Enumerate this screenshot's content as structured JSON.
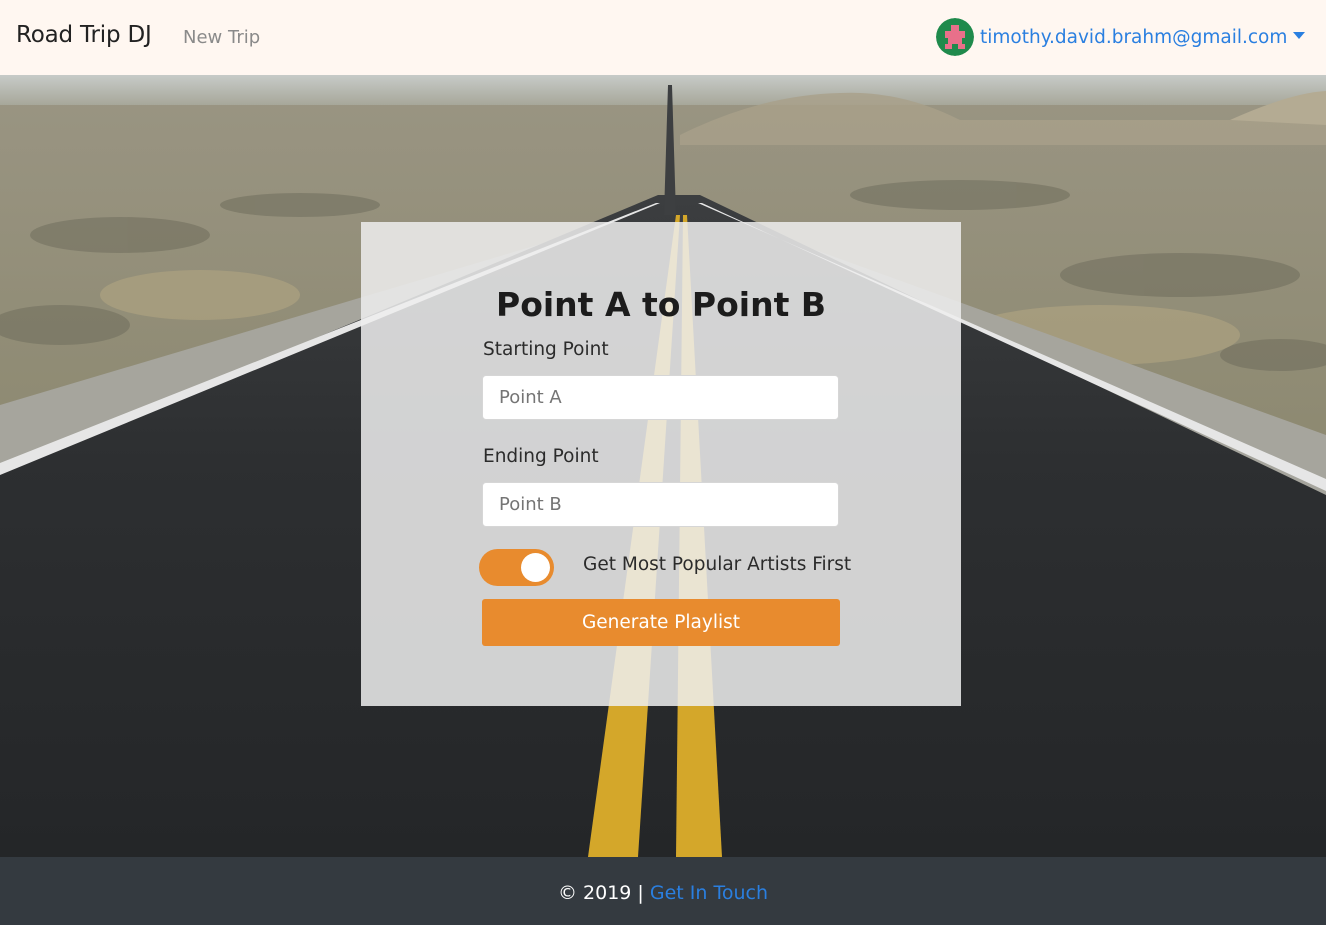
{
  "navbar": {
    "brand": "Road Trip DJ",
    "new_trip_label": "New Trip",
    "user_email": "timothy.david.brahm@gmail.com",
    "accent_color": "#2a7fe0",
    "background_color": "#fff7f1"
  },
  "form": {
    "title": "Point A to Point B",
    "start_label": "Starting Point",
    "start_placeholder": "Point A",
    "end_label": "Ending Point",
    "end_placeholder": "Point B",
    "popular_toggle_label": "Get Most Popular Artists First",
    "popular_toggle_on": true,
    "submit_label": "Generate Playlist",
    "accent_color": "#e88b2e"
  },
  "footer": {
    "copyright": "© 2019 |",
    "contact_link": "Get In Touch"
  }
}
